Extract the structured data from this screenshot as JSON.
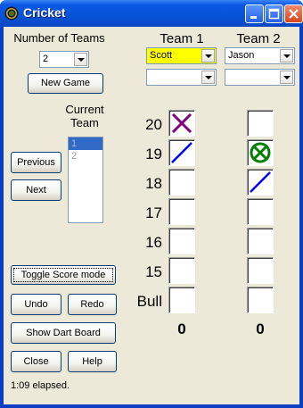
{
  "window": {
    "title": "Cricket"
  },
  "left": {
    "num_teams_label": "Number of Teams",
    "num_teams_value": "2",
    "new_game_label": "New Game",
    "current_team_label_1": "Current",
    "current_team_label_2": "Team",
    "teams_list": [
      "1",
      "2"
    ],
    "previous_label": "Previous",
    "next_label": "Next",
    "toggle_score_label": "Toggle Score mode",
    "undo_label": "Undo",
    "redo_label": "Redo",
    "show_board_label": "Show Dart Board",
    "close_label": "Close",
    "help_label": "Help",
    "status": "1:09 elapsed."
  },
  "teams": [
    {
      "header": "Team 1",
      "player1": "Scott",
      "player2": "",
      "score": "0",
      "marks": [
        "x",
        "slash",
        "",
        "",
        "",
        "",
        ""
      ]
    },
    {
      "header": "Team 2",
      "player1": "Jason",
      "player2": "",
      "score": "0",
      "marks": [
        "",
        "circle-x",
        "slash",
        "",
        "",
        "",
        ""
      ]
    }
  ],
  "numbers": [
    "20",
    "19",
    "18",
    "17",
    "16",
    "15",
    "Bull"
  ],
  "colors": {
    "highlight": "#ffff00",
    "x_mark": "#800080",
    "slash_mark": "#0000ff",
    "circle_mark": "#008000"
  }
}
